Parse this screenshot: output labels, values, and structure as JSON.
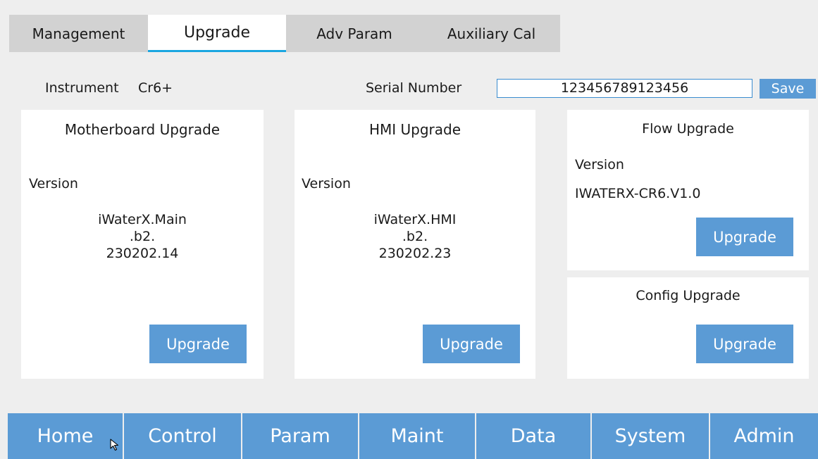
{
  "tabs": [
    {
      "label": "Management",
      "active": false
    },
    {
      "label": "Upgrade",
      "active": true
    },
    {
      "label": "Adv Param",
      "active": false
    },
    {
      "label": "Auxiliary Cal",
      "active": false
    }
  ],
  "instrument": {
    "label": "Instrument",
    "value": "Cr6+"
  },
  "serial": {
    "label": "Serial Number",
    "value": "123456789123456",
    "save_label": "Save"
  },
  "motherboard": {
    "title": "Motherboard Upgrade",
    "version_label": "Version",
    "version_lines": [
      "iWaterX.Main",
      ".b2.",
      "230202.14"
    ],
    "button": "Upgrade"
  },
  "hmi": {
    "title": "HMI Upgrade",
    "version_label": "Version",
    "version_lines": [
      "iWaterX.HMI",
      ".b2.",
      "230202.23"
    ],
    "button": "Upgrade"
  },
  "flow": {
    "title": "Flow Upgrade",
    "version_label": "Version",
    "version_value": "IWATERX-CR6.V1.0",
    "button": "Upgrade"
  },
  "config": {
    "title": "Config Upgrade",
    "button": "Upgrade"
  },
  "nav": [
    "Home",
    "Control",
    "Param",
    "Maint",
    "Data",
    "System",
    "Admin"
  ],
  "colors": {
    "accent": "#5b9bd5",
    "tab_underline": "#1aa6e0",
    "tab_inactive": "#d2d2d2",
    "background": "#eeeeee"
  }
}
